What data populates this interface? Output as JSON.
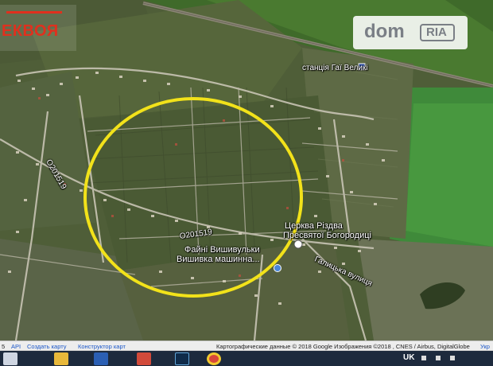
{
  "brand": {
    "name": "ЕКВОЯ"
  },
  "dom_ria": {
    "dom": "dom",
    "ria": "RIA"
  },
  "map_labels": {
    "station": "станція Гаї Великі",
    "road_1": "O201519",
    "road_2": "O201519",
    "church_line1": "Церква Різдва",
    "church_line2": "Пресвятої Богородиці",
    "poi_line1": "Файні Вишивульки",
    "poi_line2": "Вишивка машинна...",
    "street": "Галицька вулиця"
  },
  "highlight": {
    "shape": "circle",
    "color": "#f2e21a"
  },
  "attribution": {
    "first": "5",
    "api": "API",
    "create_map": "Создать карту",
    "constructor": "Конструктор карт",
    "data": "Картографические данные © 2018 Google Изображения ©2018 , CNES / Airbus, DigitalGlobe",
    "lang": "Укр"
  },
  "taskbar": {
    "lang": "UK",
    "apps": [
      "windows-icon",
      "folder-icon",
      "word-icon",
      "lightroom-icon",
      "app-icon",
      "chrome-icon"
    ]
  }
}
